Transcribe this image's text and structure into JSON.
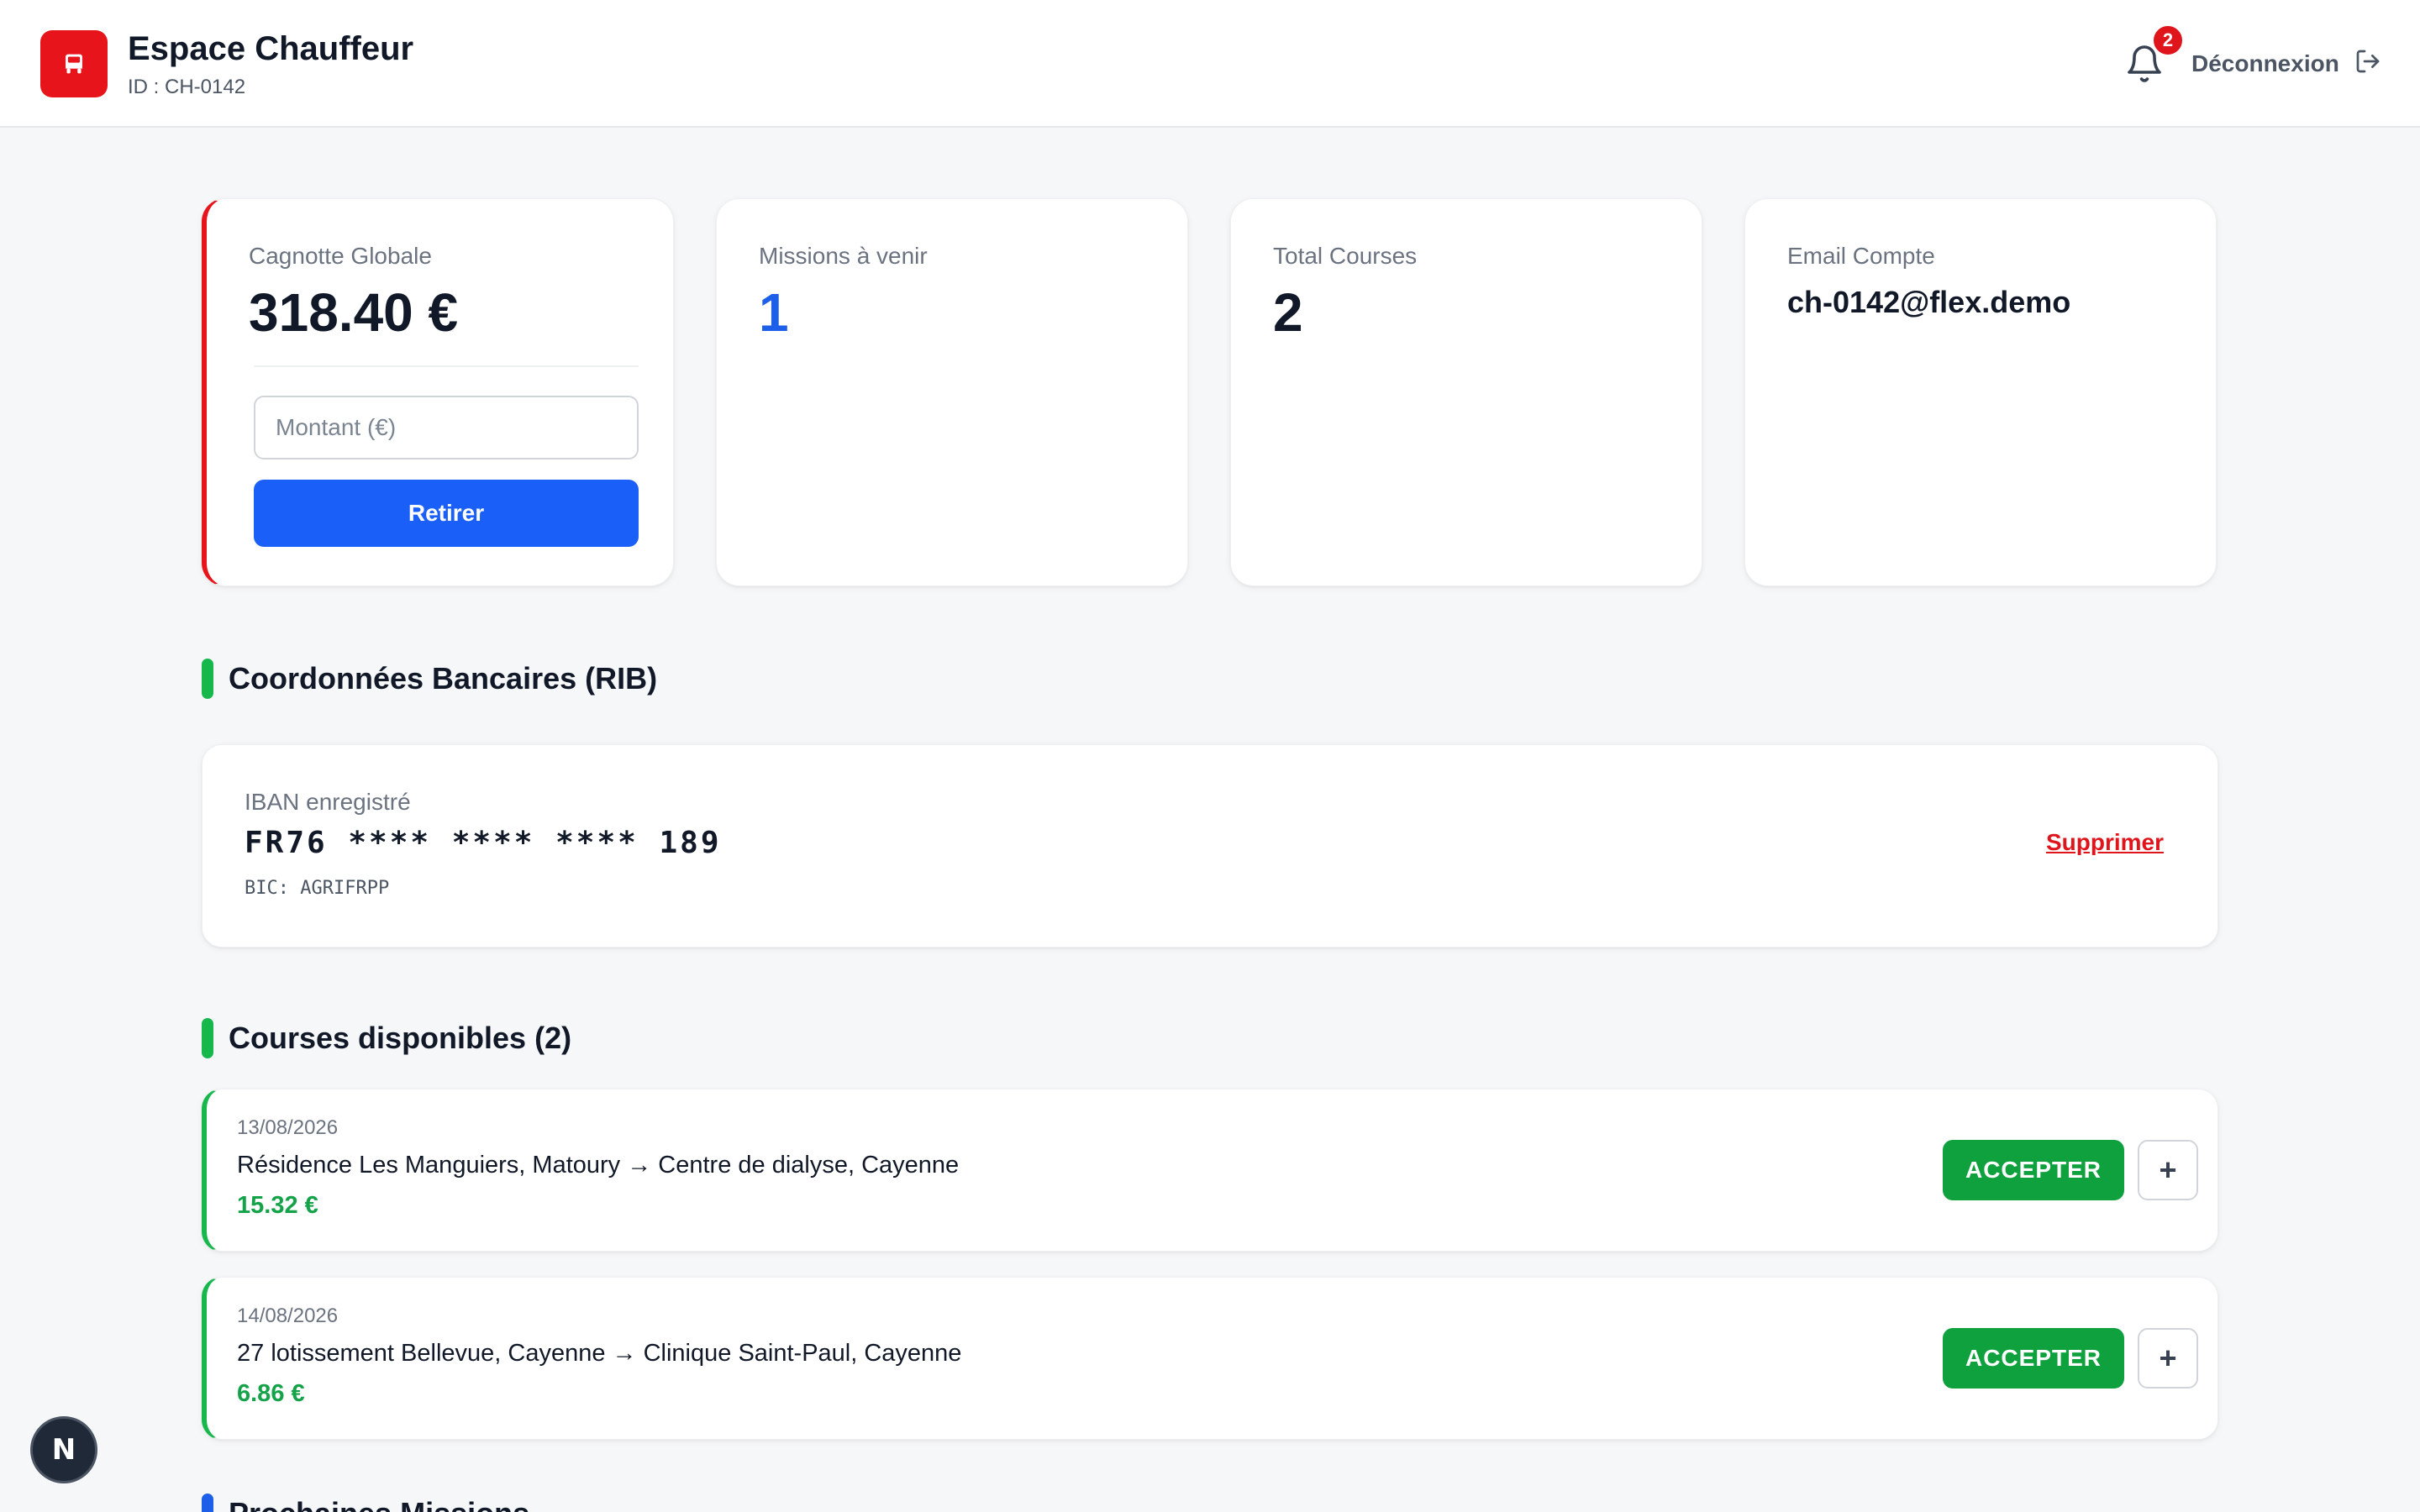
{
  "header": {
    "title": "Espace Chauffeur",
    "driver_id": "ID : CH-0142",
    "notification_count": "2",
    "logout_label": "Déconnexion",
    "logo_icon": "car-icon",
    "bell_icon": "bell-icon",
    "logout_icon": "logout-icon"
  },
  "stats": {
    "wallet": {
      "label": "Cagnotte Globale",
      "value": "318.40 €",
      "amount_placeholder": "Montant (€)",
      "withdraw_label": "Retirer"
    },
    "upcoming": {
      "label": "Missions à venir",
      "value": "1"
    },
    "total": {
      "label": "Total Courses",
      "value": "2"
    },
    "email": {
      "label": "Email Compte",
      "value": "ch-0142@flex.demo"
    }
  },
  "rib": {
    "section_title": "Coordonnées Bancaires (RIB)",
    "label": "IBAN enregistré",
    "iban": "FR76 **** **** **** 189",
    "bic": "BIC: AGRIFRPP",
    "delete_label": "Supprimer"
  },
  "courses": {
    "section_title": "Courses disponibles (2)",
    "accept_label": "ACCEPTER",
    "plus_label": "+",
    "items": [
      {
        "date": "13/08/2026",
        "route": "Résidence Les Manguiers, Matoury → Centre de dialyse, Cayenne",
        "price": "15.32 €"
      },
      {
        "date": "14/08/2026",
        "route": "27 lotissement Bellevue, Cayenne → Clinique Saint-Paul, Cayenne",
        "price": "6.86 €"
      }
    ]
  },
  "missions": {
    "section_title": "Prochaines Missions"
  },
  "floating": {
    "label": "N"
  },
  "colors": {
    "brand": "#e8141c",
    "primary": "#1a5ff7",
    "success": "#10a13f",
    "price": "#15a34a",
    "danger": "#e0151c"
  }
}
